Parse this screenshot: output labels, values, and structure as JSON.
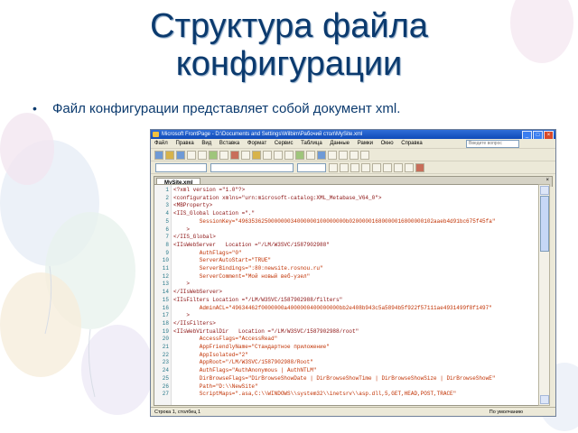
{
  "slide": {
    "title_line1": "Структура файла",
    "title_line2": "конфигурации",
    "bullet": "Файл конфигурации представляет собой документ xml."
  },
  "window": {
    "title": "Microsoft FrontPage - D:\\Documents and Settings\\Wilbim\\Рабочий стол\\MySite.xml",
    "menu": [
      "Файл",
      "Правка",
      "Вид",
      "Вставка",
      "Формат",
      "Сервис",
      "Таблица",
      "Данные",
      "Рамки",
      "Окно",
      "Справка"
    ],
    "help_placeholder": "Введите вопрос",
    "tab_label": "MySite.xml",
    "status_left": "Строка 1, столбец 1",
    "status_right": "По умолчанию"
  },
  "code_lines": [
    {
      "n": "1",
      "t": "<?xml version =\"1.0\"?>"
    },
    {
      "n": "2",
      "t": "<configuration xmlns=\"urn:microsoft-catalog:XML_Metabase_V64_0\">"
    },
    {
      "n": "3",
      "t": "<MBProperty>"
    },
    {
      "n": "4",
      "t": "<IIS_Global Location =\".\""
    },
    {
      "n": "5",
      "t": "        SessionKey=\"496353625000000034000000100000000b02000001680000016800000102aaeb4d91bc675f45fa\""
    },
    {
      "n": "6",
      "t": "    >"
    },
    {
      "n": "7",
      "t": "</IIS_Global>"
    },
    {
      "n": "8",
      "t": "<IIsWebServer   Location =\"/LM/W3SVC/1587902988\""
    },
    {
      "n": "9",
      "t": "        AuthFlags=\"0\""
    },
    {
      "n": "10",
      "t": "        ServerAutoStart=\"TRUE\""
    },
    {
      "n": "11",
      "t": "        ServerBindings=\":80:newsite.rosnou.ru\""
    },
    {
      "n": "12",
      "t": "        ServerComment=\"Мой новый веб-узел\""
    },
    {
      "n": "13",
      "t": "    >"
    },
    {
      "n": "14",
      "t": "</IIsWebServer>"
    },
    {
      "n": "15",
      "t": "<IIsFilters Location =\"/LM/W3SVC/1587902988/filters\""
    },
    {
      "n": "16",
      "t": "        AdminACL=\"49634462f0000000a4000000400000000bb2e408b943c5a5894b5f922f57111ae4931499f8f1497\""
    },
    {
      "n": "17",
      "t": "    >"
    },
    {
      "n": "18",
      "t": "</IIsFilters>"
    },
    {
      "n": "19",
      "t": "<IIsWebVirtualDir   Location =\"/LM/W3SVC/1587902988/root\""
    },
    {
      "n": "20",
      "t": "        AccessFlags=\"AccessRead\""
    },
    {
      "n": "21",
      "t": "        AppFriendlyName=\"Стандартное приложение\""
    },
    {
      "n": "22",
      "t": "        AppIsolated=\"2\""
    },
    {
      "n": "23",
      "t": "        AppRoot=\"/LM/W3SVC/1587902988/Root\""
    },
    {
      "n": "24",
      "t": "        AuthFlags=\"AuthAnonymous | AuthNTLM\""
    },
    {
      "n": "25",
      "t": "        DirBrowseFlags=\"DirBrowseShowDate | DirBrowseShowTime | DirBrowseShowSize | DirBrowseShowE\""
    },
    {
      "n": "26",
      "t": "        Path=\"D:\\\\NewSite\""
    },
    {
      "n": "27",
      "t": "        ScriptMaps=\".asa,C:\\\\WINDOWS\\\\system32\\\\inetsrv\\\\asp.dll,5,GET,HEAD,POST,TRACE\""
    }
  ],
  "colors": {
    "title": "#0b3a6e",
    "titlebar": "#0f4ab8",
    "line_numbers": "#2a7a8a"
  }
}
